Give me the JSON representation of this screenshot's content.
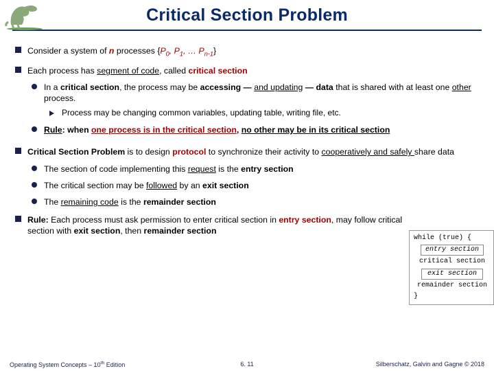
{
  "title": "Critical Section Problem",
  "bullets": {
    "b1_pre": "Consider a system of ",
    "b1_n": "n",
    "b1_mid": " processes {",
    "b1_p0": "P",
    "b1_s0": "0",
    "b1_c1": ", ",
    "b1_p1": "P",
    "b1_s1": "1",
    "b1_c2": ", … ",
    "b1_pn": "P",
    "b1_sn": "n-1",
    "b1_end": "}",
    "b2_a": "Each process has ",
    "b2_b": "segment of code",
    "b2_c": ", called ",
    "b2_d": "critical section",
    "b2_1a": "In a ",
    "b2_1b": "critical section",
    "b2_1c": ", the process may be ",
    "b2_1d": "accessing — ",
    "b2_1e": "and updating",
    "b2_1f": " — data",
    "b2_1g": " that is shared with at least one ",
    "b2_1h": "other",
    "b2_1i": " process.",
    "b2_1_1": "Process may be changing common variables, updating table, writing file, etc.",
    "b2_2a": "Rule",
    "b2_2b": ": when ",
    "b2_2c": "one process is in the critical section",
    "b2_2d": ", ",
    "b2_2e": "no other may be in its critical section",
    "b3_a": "Critical Section Problem",
    "b3_b": " is to design ",
    "b3_c": "protocol",
    "b3_d": " to synchronize their activity to ",
    "b3_e": "cooperatively and safely ",
    "b3_f": "share data",
    "b3_1a": "The section of code implementing this ",
    "b3_1b": "request",
    "b3_1c": " is the ",
    "b3_1d": "entry section",
    "b3_2a": "The critical section may be ",
    "b3_2b": "followed",
    "b3_2c": " by an ",
    "b3_2d": "exit section",
    "b3_3a": "The ",
    "b3_3b": "remaining code",
    "b3_3c": " is the ",
    "b3_3d": "remainder section",
    "b4_a": "Rule: ",
    "b4_b": "Each process must ask permission to enter critical section in ",
    "b4_c": "entry section",
    "b4_d": ", may follow critical section with ",
    "b4_e": "exit section",
    "b4_f": ", then ",
    "b4_g": "remainder section"
  },
  "code": {
    "l1": "while (true) {",
    "l2": "entry section",
    "l3": "critical section",
    "l4": "exit section",
    "l5": "remainder section",
    "l6": "}"
  },
  "footer": {
    "left_a": "Operating System Concepts – 10",
    "left_b": "th",
    "left_c": " Edition",
    "mid": "6. 11",
    "right": "Silberschatz, Galvin and Gagne © 2018"
  }
}
